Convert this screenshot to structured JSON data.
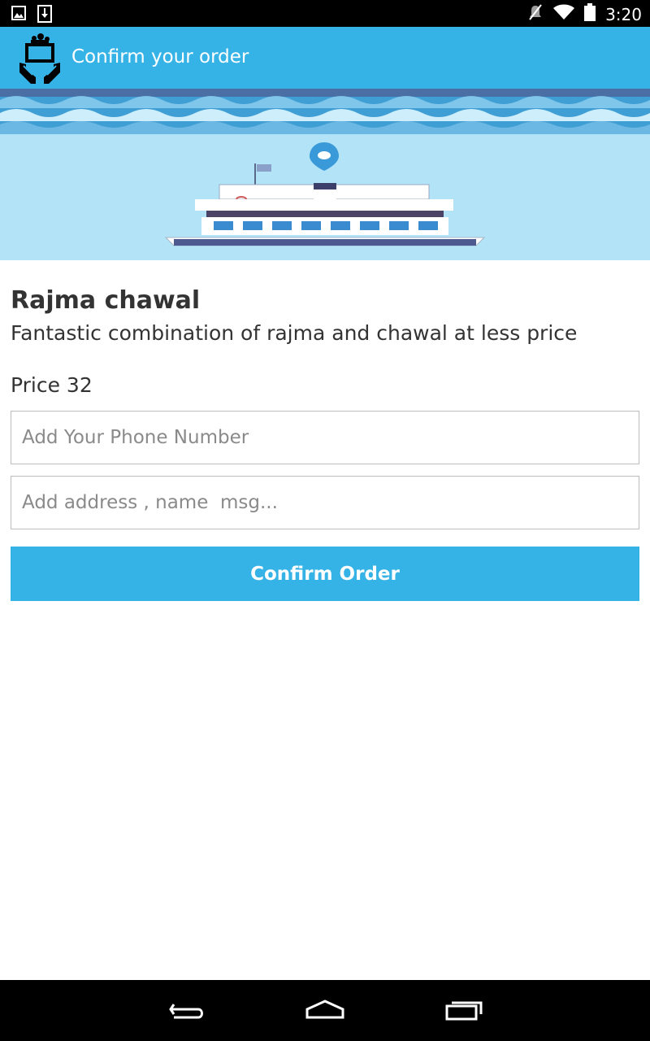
{
  "status_bar": {
    "time": "3:20",
    "icons": [
      "gallery-icon",
      "download-icon",
      "mute-icon",
      "wifi-icon",
      "battery-icon"
    ]
  },
  "app_bar": {
    "title": "Confirm your order",
    "logo": "serving-hands-logo-icon",
    "color": "#35b3e6"
  },
  "banner": {
    "image": "ferry-boat-illustration"
  },
  "product": {
    "name": "Rajma chawal",
    "description": "Fantastic combination of rajma and chawal at less price",
    "price_label": "Price 32"
  },
  "form": {
    "phone_placeholder": "Add Your Phone Number",
    "phone_value": "",
    "address_placeholder": "Add address , name  msg...",
    "address_value": "",
    "confirm_label": "Confirm Order"
  },
  "nav_bar": {
    "icons": [
      "back-icon",
      "home-icon",
      "recents-icon"
    ]
  }
}
